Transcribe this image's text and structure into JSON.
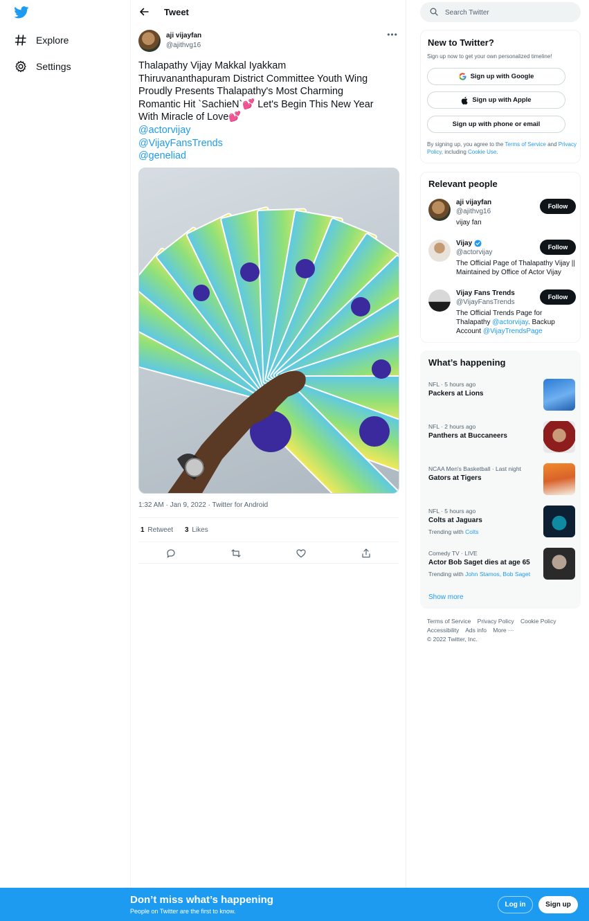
{
  "brand": {
    "accent": "#1d9bf0",
    "logo_icon": "twitter-bird-icon"
  },
  "nav": {
    "items": [
      {
        "label": "Explore",
        "icon": "hashtag-icon"
      },
      {
        "label": "Settings",
        "icon": "gear-icon"
      }
    ]
  },
  "header": {
    "title": "Tweet",
    "back_icon": "back-arrow-icon"
  },
  "tweet": {
    "author_name": "aji vijayfan",
    "author_handle": "@ajithvg16",
    "text_line1": "Thalapathy Vijay Makkal Iyakkam",
    "text_line2": "Thiruvananthapuram District Committee Youth Wing",
    "text_line3": "Proudly Presents  Thalapathy's Most Charming",
    "text_line4": "Romantic Hit `SachieN`",
    "text_line4b": " Let's Begin This New Year",
    "text_line5": "With Miracle of Love",
    "heart_emoji": "💕",
    "mentions": [
      "@actorvijay",
      "@VijayFansTrends",
      "@geneliad"
    ],
    "meta": "1:32 AM · Jan 9, 2022 · Twitter for Android",
    "retweets_count": "1",
    "retweets_label": "Retweet",
    "likes_count": "3",
    "likes_label": "Likes"
  },
  "search": {
    "placeholder": "Search Twitter"
  },
  "new_to_twitter": {
    "title": "New to Twitter?",
    "subtitle": "Sign up now to get your own personalized timeline!",
    "google": "Sign up with Google",
    "apple": "Sign up with Apple",
    "phone": "Sign up with phone or email",
    "legal_prefix": "By signing up, you agree to the ",
    "terms": "Terms of Service",
    "and": " and ",
    "privacy": "Privacy Policy",
    "including": ", including ",
    "cookie": "Cookie Use",
    "period": "."
  },
  "relevant_people": {
    "title": "Relevant people",
    "follow_label": "Follow",
    "people": [
      {
        "name": "aji vijayfan",
        "handle": "@ajithvg16",
        "bio": "vijay fan"
      },
      {
        "name": "Vijay",
        "handle": "@actorvijay",
        "bio": "The Official Page of Thalapathy Vijay || Maintained by Office of Actor Vijay"
      },
      {
        "name": "Vijay Fans Trends",
        "handle": "@VijayFansTrends",
        "bio_pre": "The Official Trends Page for Thalapathy ",
        "bio_link1": "@actorvijay",
        "bio_mid": ". Backup Account ",
        "bio_link2": "@VijayTrendsPage"
      }
    ]
  },
  "whats_happening": {
    "title": "What’s happening",
    "trends": [
      {
        "context": "NFL · 5 hours ago",
        "name": "Packers at Lions"
      },
      {
        "context": "NFL · 2 hours ago",
        "name": "Panthers at Buccaneers"
      },
      {
        "context": "NCAA Men's Basketball · Last night",
        "name": "Gators at Tigers"
      },
      {
        "context": "NFL · 5 hours ago",
        "name": "Colts at Jaguars",
        "with_label": "Trending with ",
        "with_links": "Colts"
      },
      {
        "context": "Comedy TV · LIVE",
        "name": "Actor Bob Saget dies at age 65",
        "with_label": "Trending with ",
        "with_links": "John Stamos, Bob Saget"
      }
    ],
    "show_more": "Show more"
  },
  "footer": {
    "links": [
      "Terms of Service",
      "Privacy Policy",
      "Cookie Policy",
      "Accessibility",
      "Ads info",
      "More ···"
    ],
    "copyright": "© 2022 Twitter, Inc."
  },
  "bottom_bar": {
    "title": "Don’t miss what’s happening",
    "subtitle": "People on Twitter are the first to know.",
    "login": "Log in",
    "signup": "Sign up"
  }
}
